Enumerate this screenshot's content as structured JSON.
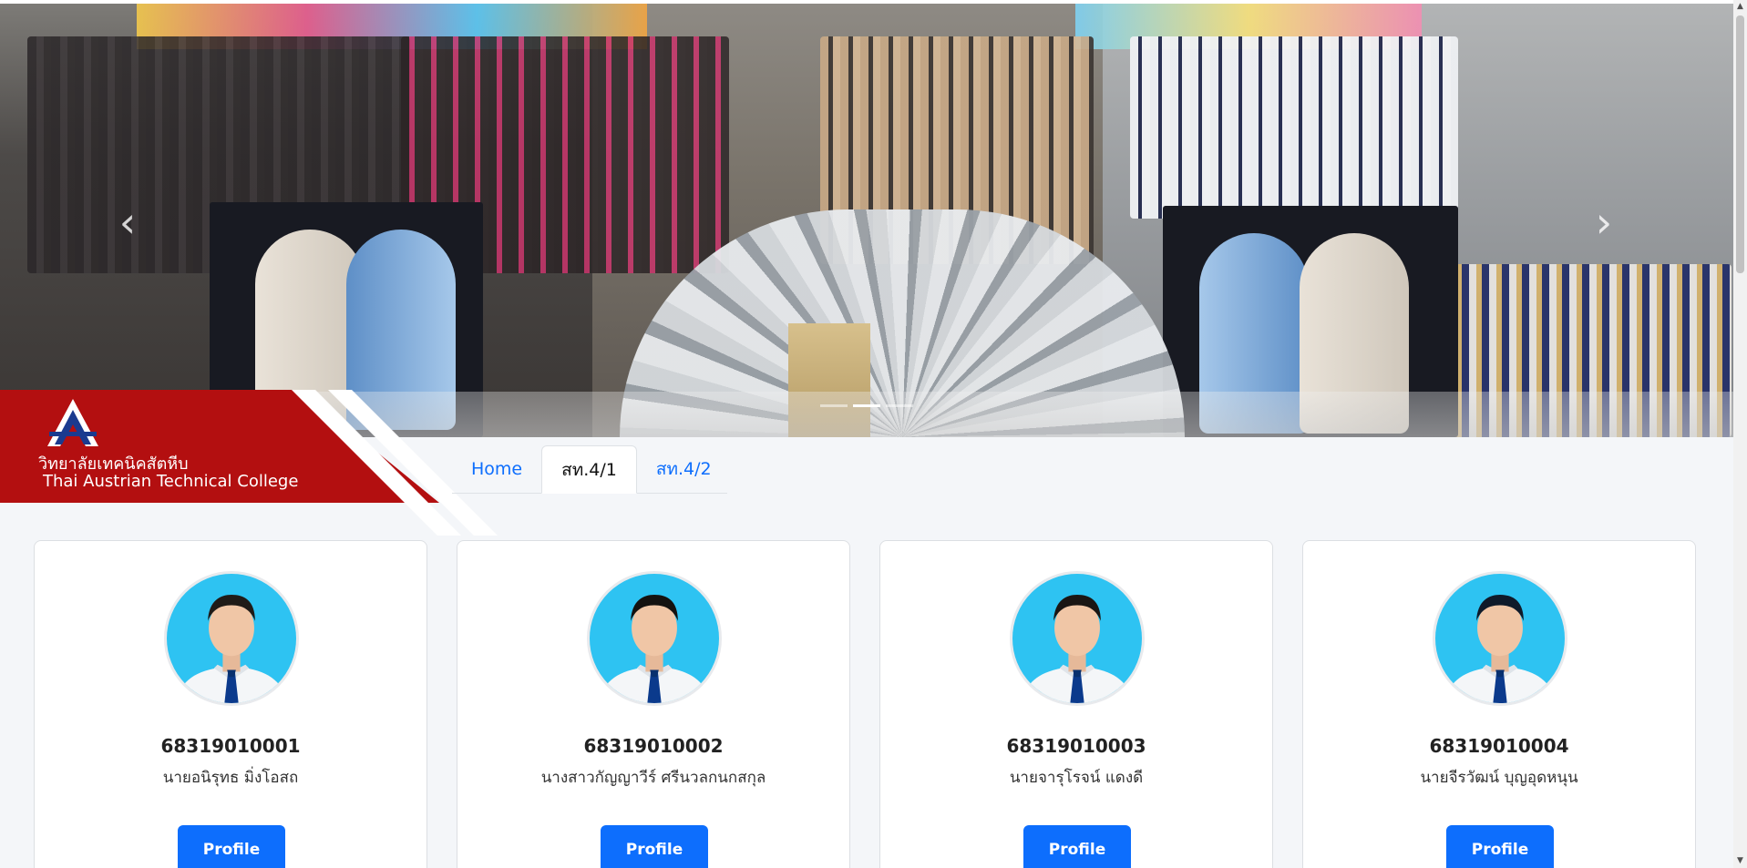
{
  "hero": {
    "prev_icon": "chevron-left-icon",
    "next_icon": "chevron-right-icon",
    "prev_glyph": "‹",
    "next_glyph": "›",
    "slide_count": 3,
    "active_slide": 2
  },
  "school": {
    "name_th": "วิทยาลัยเทคนิคสัตหีบ",
    "name_en": "Thai Austrian Technical College",
    "brand_color": "#b30f10"
  },
  "tabs": [
    {
      "label": "Home",
      "active": false
    },
    {
      "label": "สท.4/1",
      "active": true
    },
    {
      "label": "สท.4/2",
      "active": false
    }
  ],
  "students": [
    {
      "id": "68319010001",
      "name": "นายอนิรุทธ มิ่งโอสถ",
      "button": "Profile"
    },
    {
      "id": "68319010002",
      "name": "นางสาวกัญญาวีร์ ศรีนวลกนกสกุล",
      "button": "Profile"
    },
    {
      "id": "68319010003",
      "name": "นายจารุโรจน์ แดงดี",
      "button": "Profile"
    },
    {
      "id": "68319010004",
      "name": "นายจีรวัฒน์ บุญอุดหนุน",
      "button": "Profile"
    }
  ],
  "colors": {
    "accent": "#0d6efd",
    "avatar_bg": "#2ec3f2",
    "tie": "#0b3a8c"
  },
  "scrollbar": {
    "up_glyph": "▲",
    "down_glyph": "▼"
  }
}
